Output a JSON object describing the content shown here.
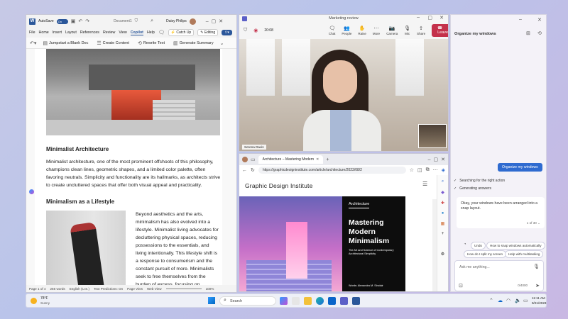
{
  "word": {
    "autosave": "AutoSave",
    "toggle": "On",
    "doc_name": "Document1",
    "user": "Daisy Philips",
    "menu": [
      "File",
      "Home",
      "Insert",
      "Layout",
      "References",
      "Review",
      "View",
      "Copilot",
      "Help"
    ],
    "catch_up": "Catch Up",
    "editing": "Editing",
    "ribbon": [
      "Jumpstart a Blank Doc",
      "Create Content",
      "Rewrite Text",
      "Generate Summary"
    ],
    "heading1": "Minimalist Architecture",
    "para1": "Minimalist architecture, one of the most prominent offshoots of this philosophy, champions clean lines, geometric shapes, and a limited color palette, often favoring neutrals. Simplicity and functionality are its hallmarks, as architects strive to create uncluttered spaces that offer both visual appeal and practicality.",
    "heading2": "Minimalism as a Lifestyle",
    "para2": "Beyond aesthetics and the arts, minimalism has also evolved into a lifestyle. Minimalist living advocates for decluttering physical spaces, reducing possessions to the essentials, and living intentionally. This lifestyle shift is a response to consumerism and the constant pursuit of more. Minimalists seek to free themselves from the burden of excess, focusing on experiences, relationships, and personal growth instead.",
    "status": [
      "Page 1 of 4",
      "256 words",
      "English (U.S.)",
      "Text Predictions: On",
      "Page View",
      "Web View",
      "100%"
    ]
  },
  "teams": {
    "title": "Marketing review",
    "timer": "20:08",
    "controls": [
      "Chat",
      "People",
      "Raise",
      "More",
      "Camera",
      "Mic",
      "Share"
    ],
    "leave": "Leave",
    "speaker": "Serena Davis"
  },
  "edge": {
    "tab_title": "Architecture – Mastering Modern",
    "url": "https://graphicdesigninstitute.com/article/architecture/2023/08/2",
    "site_name": "Graphic Design Institute",
    "category": "Architecture",
    "headline": "Mastering Modern Minimalism",
    "subhead": "The Art and Science of Contemporary Architectural Simplicity",
    "byline": "Words: Alexandra M. Sinclair"
  },
  "copilot": {
    "title": "Organize my windows",
    "user_msg": "Organize my windows",
    "steps": [
      "Searching for the right action",
      "Generating answers"
    ],
    "reply": "Okay, your windows have been arranged into a snap layout.",
    "pager": "1 of 30",
    "chips": [
      "Undo",
      "How to snap windows automatically",
      "How do I split my screen",
      "Help with multitasking"
    ],
    "ask_placeholder": "Ask me anything...",
    "counter": "0/4000"
  },
  "taskbar": {
    "temp": "78°F",
    "weather": "Sunny",
    "search": "Search",
    "time": "11:11 AM",
    "date": "9/21/2023"
  }
}
